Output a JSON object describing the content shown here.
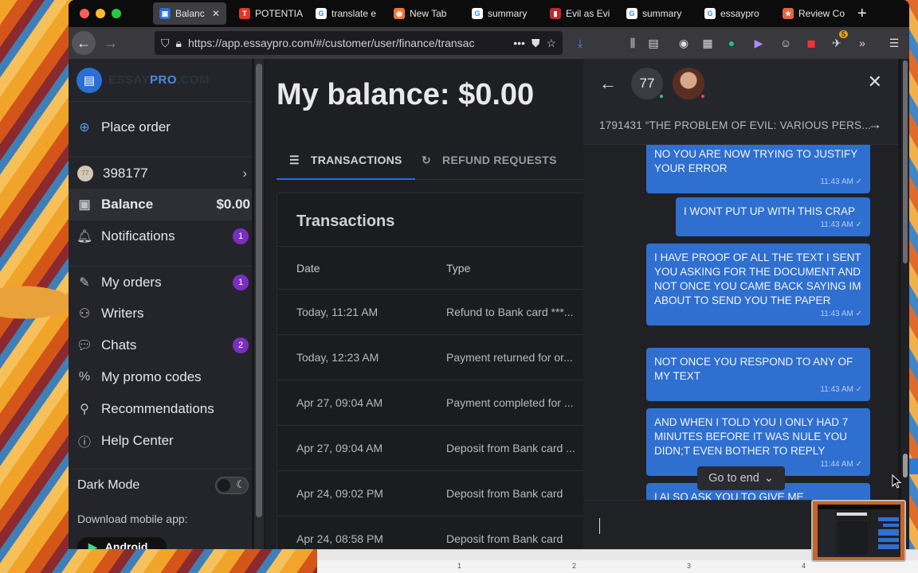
{
  "browser": {
    "tabs": [
      {
        "label": "Balanc",
        "favicon": "essaypro-icon",
        "active": true
      },
      {
        "label": "POTENTIA",
        "favicon": "t-icon"
      },
      {
        "label": "translate e",
        "favicon": "google-icon"
      },
      {
        "label": "New Tab",
        "favicon": "firefox-icon"
      },
      {
        "label": "summary",
        "favicon": "google-icon"
      },
      {
        "label": "Evil as Evi",
        "favicon": "red-book-icon"
      },
      {
        "label": "summary",
        "favicon": "google-icon"
      },
      {
        "label": "essaypro",
        "favicon": "google-icon"
      },
      {
        "label": "Review Co",
        "favicon": "star-icon"
      }
    ],
    "url": "https://app.essaypro.com/#/customer/user/finance/transac",
    "extension_badge": "5"
  },
  "sidebar": {
    "logo_text_a": "ESSAY",
    "logo_text_b": "PRO",
    "logo_text_c": ".COM",
    "place_order": "Place order",
    "user_id": "398177",
    "avatar_text": "77",
    "balance_label": "Balance",
    "balance_value": "$0.00",
    "items": [
      {
        "label": "Notifications",
        "badge": "1"
      },
      {
        "label": "My orders",
        "badge": "1"
      },
      {
        "label": "Writers"
      },
      {
        "label": "Chats",
        "badge": "2"
      },
      {
        "label": "My promo codes"
      },
      {
        "label": "Recommendations"
      },
      {
        "label": "Help Center"
      }
    ],
    "dark_mode": "Dark Mode",
    "download_label": "Download mobile app:",
    "android_label": "Android"
  },
  "main": {
    "title": "My balance: $0.00",
    "tabs": [
      "TRANSACTIONS",
      "REFUND REQUESTS"
    ],
    "card_title": "Transactions",
    "columns": [
      "Date",
      "Type"
    ],
    "rows": [
      {
        "date": "Today, 11:21 AM",
        "type": "Refund to Bank card ***..."
      },
      {
        "date": "Today, 12:23 AM",
        "type": "Payment returned for or..."
      },
      {
        "date": "Apr 27, 09:04 AM",
        "type": "Payment completed for ..."
      },
      {
        "date": "Apr 27, 09:04 AM",
        "type": "Deposit from Bank card ..."
      },
      {
        "date": "Apr 24, 09:02 PM",
        "type": "Deposit from Bank card"
      },
      {
        "date": "Apr 24, 08:58 PM",
        "type": "Deposit from Bank card"
      }
    ]
  },
  "chat": {
    "participant_num": "77",
    "order_title": "1791431 “THE PROBLEM OF EVIL: VARIOUS PERS...",
    "messages": [
      {
        "text": "NO YOU ARE NOW TRYING TO JUSTIFY YOUR ERROR",
        "time": "11:43 AM ✓"
      },
      {
        "text": "I WONT PUT UP WITH THIS CRAP",
        "time": "11:43 AM ✓"
      },
      {
        "text": "I HAVE PROOF OF ALL THE TEXT I SENT YOU ASKING FOR THE DOCUMENT AND NOT ONCE YOU CAME BACK SAYING IM ABOUT TO SEND YOU THE PAPER",
        "time": "11:43 AM ✓"
      },
      {
        "text": "NOT ONCE YOU RESPOND TO ANY OF MY TEXT",
        "time": "11:43 AM ✓"
      },
      {
        "text": "AND WHEN I TOLD YOU I ONLY HAD 7 MINUTES BEFORE IT WAS NULE YOU DIDN;T EVEN BOTHER TO REPLY",
        "time": "11:44 AM ✓"
      },
      {
        "text": "I ALSO ASK YOU TO GIVE ME",
        "time": ""
      }
    ],
    "goto_label": "Go to end"
  },
  "ruler": [
    "1",
    "2",
    "3",
    "4"
  ],
  "colors": {
    "accent": "#2a6fd6",
    "badge": "#7b2fbf",
    "bubble": "#2f6fd0"
  }
}
